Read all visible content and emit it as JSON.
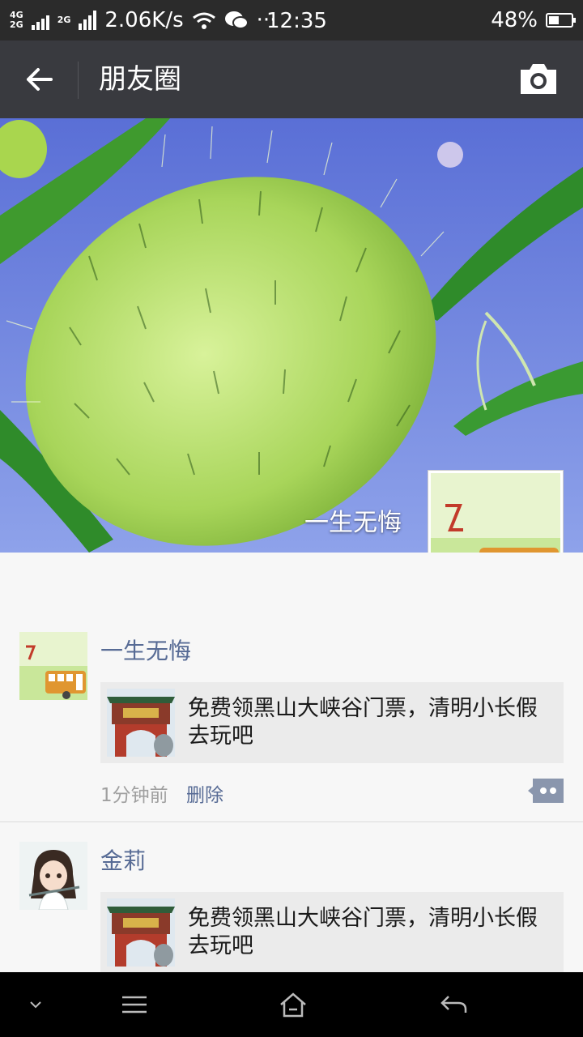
{
  "status_bar": {
    "net_top": "4G",
    "net_bottom": "2G",
    "net_second": "2G",
    "speed": "2.06K/s",
    "more": "···",
    "time": "12:35",
    "battery": "48%"
  },
  "header": {
    "title": "朋友圈",
    "back_icon": "arrow-left-icon",
    "camera_icon": "camera-icon"
  },
  "cover": {
    "user_name": "一生无悔"
  },
  "posts": [
    {
      "author": "一生无悔",
      "share_text": "免费领黑山大峡谷门票，清明小长假去玩吧",
      "time": "1分钟前",
      "delete_label": "删除"
    },
    {
      "author": "金莉",
      "share_text": "免费领黑山大峡谷门票，清明小长假去玩吧"
    }
  ],
  "nav_bar": {
    "icons": [
      "chevron-down-icon",
      "menu-icon",
      "home-icon",
      "back-icon"
    ]
  },
  "colors": {
    "title_bar": "#393a3f",
    "status_bar": "#2b2b2b",
    "link_blue": "#576b95",
    "share_bg": "#ebebeb"
  }
}
